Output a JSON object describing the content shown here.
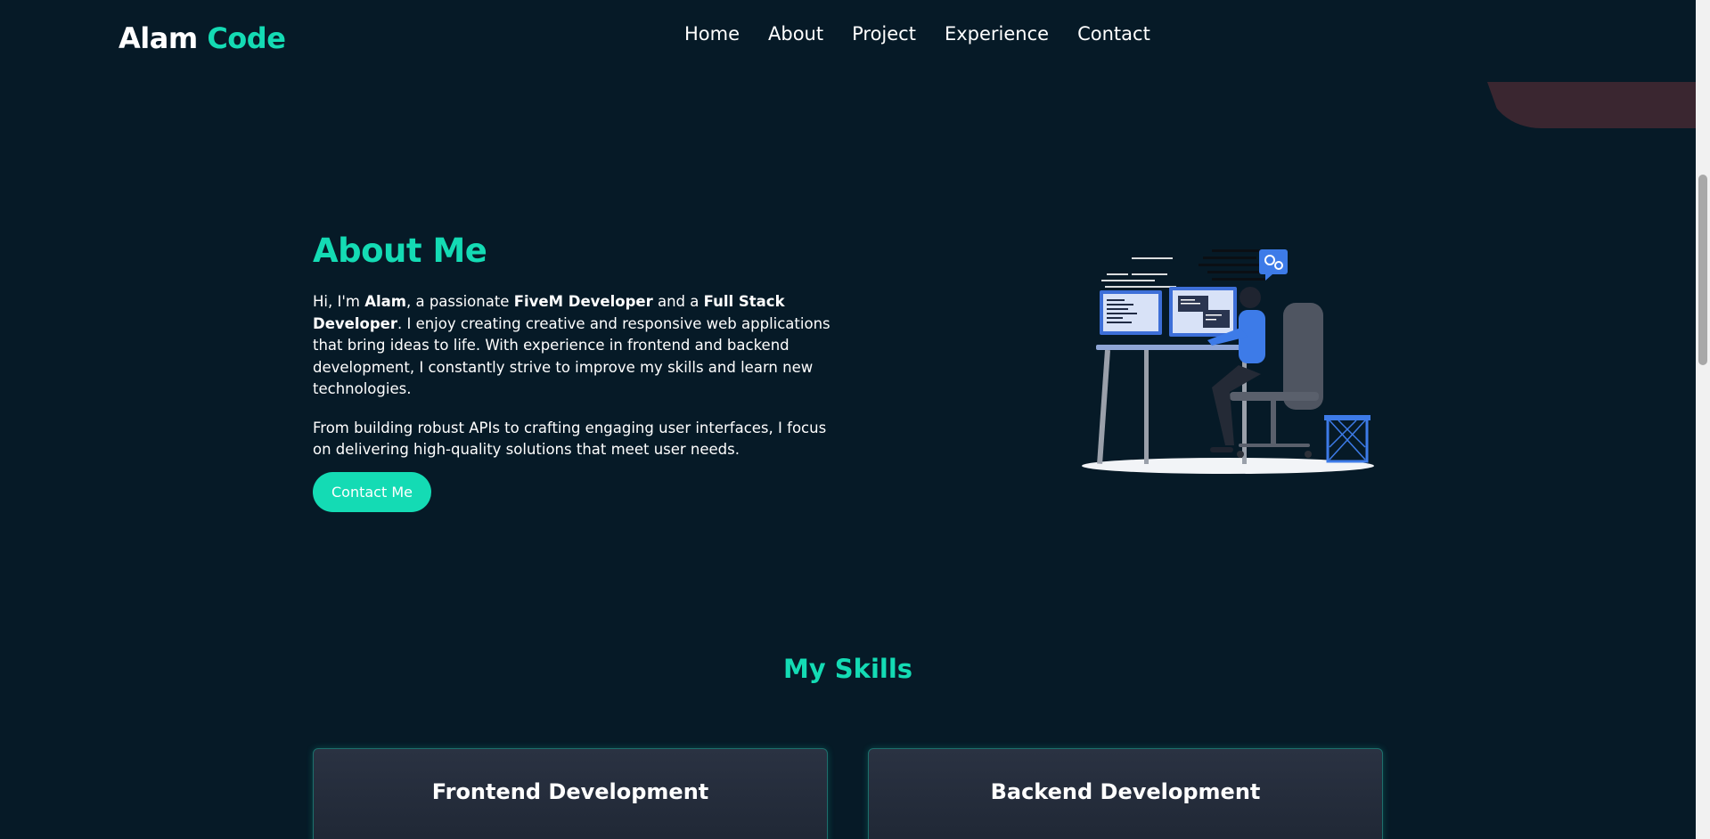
{
  "header": {
    "logo_main": "Alam",
    "logo_accent": "Code",
    "nav": [
      "Home",
      "About",
      "Project",
      "Experience",
      "Contact"
    ]
  },
  "about": {
    "title": "About Me",
    "p1": {
      "t1": "Hi, I'm ",
      "b1": "Alam",
      "t2": ", a passionate ",
      "b2": "FiveM Developer",
      "t3": " and a ",
      "b3": "Full Stack Developer",
      "t4": ". I enjoy creating creative and responsive web applications that bring ideas to life. With experience in frontend and backend development, I constantly strive to improve my skills and learn new technologies."
    },
    "p2": "From building robust APIs to crafting engaging user interfaces, I focus on delivering high-quality solutions that meet user needs.",
    "button": "Contact Me"
  },
  "skills": {
    "title": "My Skills",
    "cards": [
      "Frontend Development",
      "Backend Development"
    ]
  },
  "colors": {
    "accent": "#14dbb4",
    "background": "#061a27"
  }
}
